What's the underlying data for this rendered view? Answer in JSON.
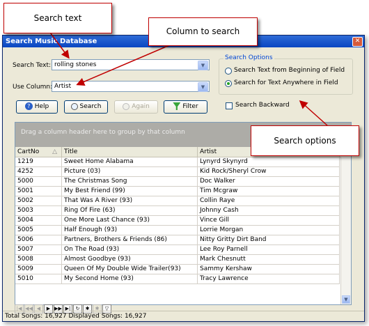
{
  "window": {
    "title": "Search Music Database"
  },
  "form": {
    "search_text_label": "Search Text:",
    "search_text_value": "rolling stones",
    "use_column_label": "Use Column:",
    "use_column_value": "Artist"
  },
  "buttons": {
    "help": "Help",
    "search": "Search",
    "again": "Again",
    "filter": "Filter"
  },
  "search_options": {
    "legend": "Search Options",
    "option_beginning": "Search Text from Beginning of Field",
    "option_anywhere": "Search for Text Anywhere in Field",
    "selected": "option_anywhere",
    "backward_label": "Search Backward",
    "backward_checked": false
  },
  "grid": {
    "group_prompt": "Drag a column header here to group by that column",
    "columns": [
      "CartNo",
      "Title",
      "Artist"
    ],
    "rows": [
      [
        "1219",
        "Sweet Home Alabama",
        "Lynyrd Skynyrd"
      ],
      [
        "4252",
        "Picture (03)",
        "Kid Rock/Sheryl Crow"
      ],
      [
        "5000",
        "The Christmas Song",
        "Doc Walker"
      ],
      [
        "5001",
        "My Best Friend (99)",
        "Tim Mcgraw"
      ],
      [
        "5002",
        "That Was A River (93)",
        "Collin Raye"
      ],
      [
        "5003",
        "Ring Of Fire (63)",
        "Johnny Cash"
      ],
      [
        "5004",
        "One More Last Chance (93)",
        "Vince Gill"
      ],
      [
        "5005",
        "Half Enough (93)",
        "Lorrie Morgan"
      ],
      [
        "5006",
        "Partners, Brothers & Friends (86)",
        "Nitty Gritty Dirt Band"
      ],
      [
        "5007",
        "On The Road (93)",
        "Lee Roy Parnell"
      ],
      [
        "5008",
        "Almost Goodbye (93)",
        "Mark Chesnutt"
      ],
      [
        "5009",
        "Queen Of My Double Wide Trailer(93)",
        "Sammy Kershaw"
      ],
      [
        "5010",
        "My Second Home (93)",
        "Tracy Lawrence"
      ]
    ]
  },
  "status_bar": "Total Songs: 16,927 Displayed Songs: 16,927",
  "callouts": {
    "search_text": "Search text",
    "column_to_search": "Column to search",
    "search_options": "Search options"
  },
  "colors": {
    "callout_border": "#c00000",
    "titlebar": "#0a46c2"
  }
}
